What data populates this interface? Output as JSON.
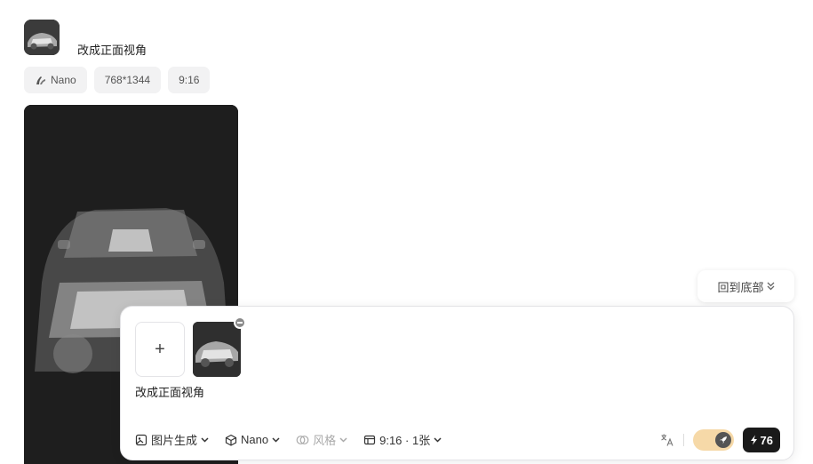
{
  "message": {
    "text": "改成正面视角",
    "tags": [
      {
        "icon": "banana-icon",
        "label": "Nano"
      },
      {
        "label": "768*1344"
      },
      {
        "label": "9:16"
      }
    ]
  },
  "scroll": {
    "back_to_bottom": "回到底部"
  },
  "composer": {
    "add_label": "+",
    "prompt": "改成正面视角",
    "toolbar": {
      "mode": "图片生成",
      "model": "Nano",
      "style": "风格",
      "ratio": "9:16 · 1张"
    },
    "credits": "76"
  },
  "colors": {
    "accent_toggle": "#f6d9a8",
    "credit_bg": "#1a1a1a"
  }
}
